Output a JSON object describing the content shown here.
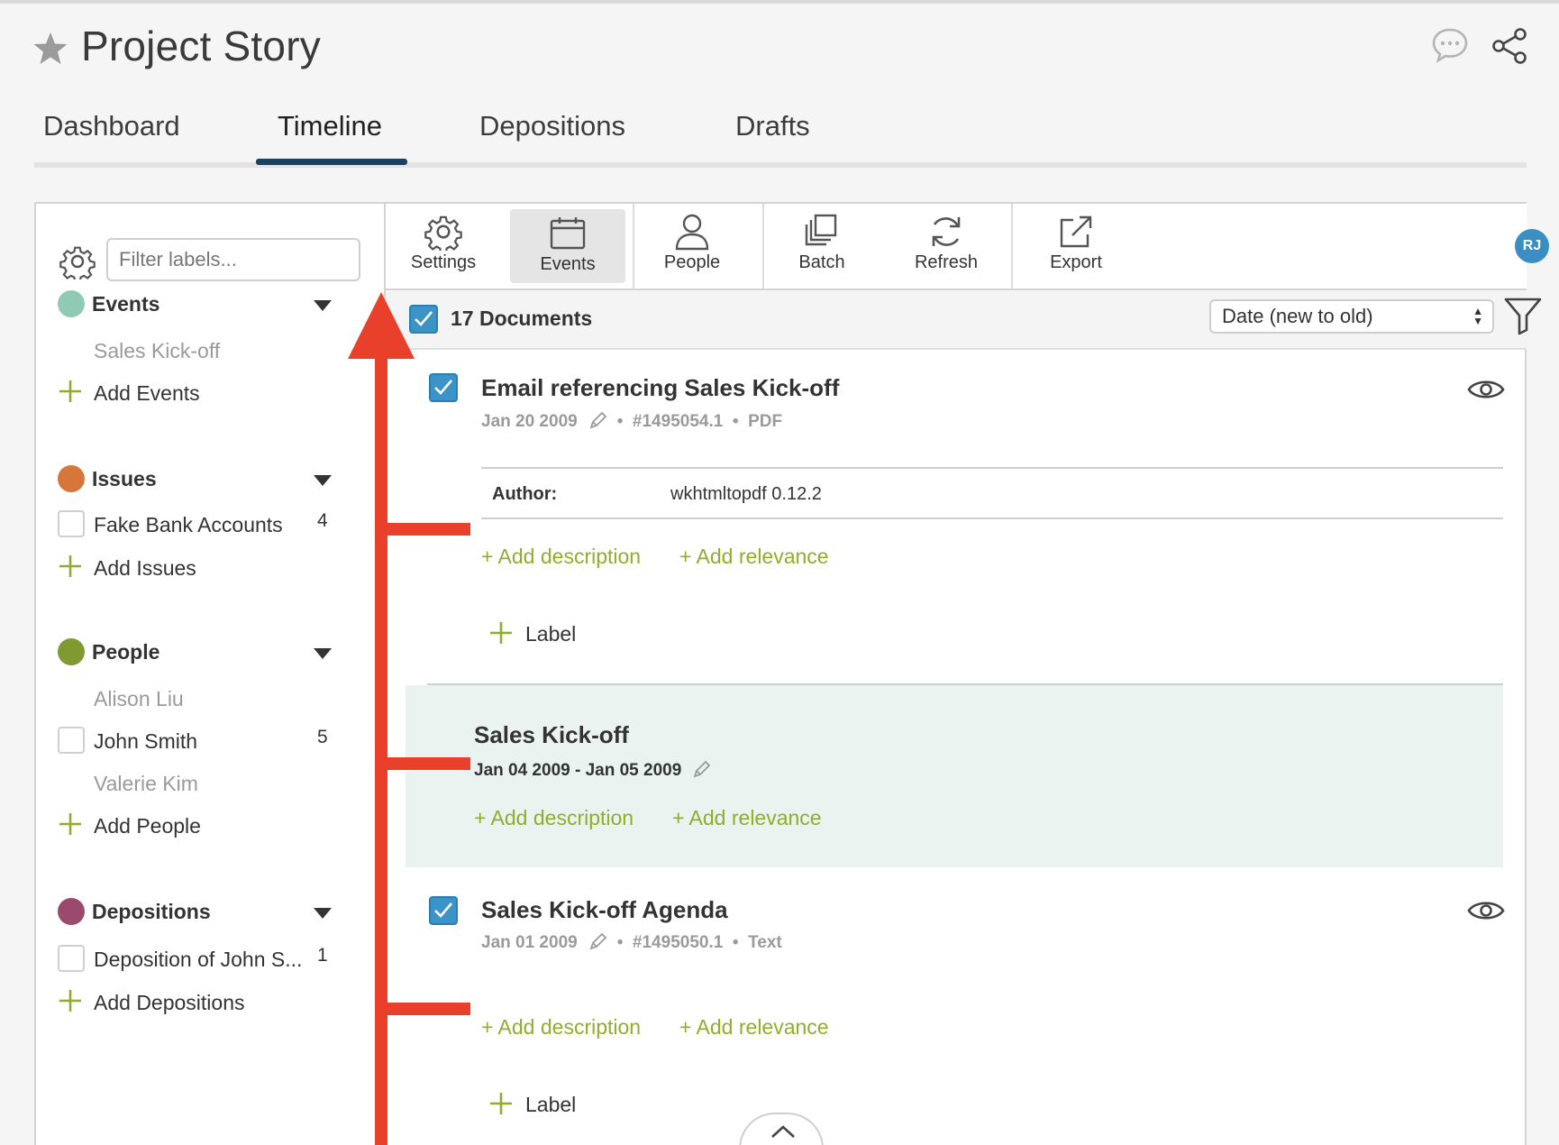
{
  "app": {
    "title": "Project Story"
  },
  "header_icons": {
    "star": "star-icon",
    "comment": "comment-icon",
    "share": "share-icon"
  },
  "tabs": [
    {
      "label": "Dashboard",
      "active": false
    },
    {
      "label": "Timeline",
      "active": true
    },
    {
      "label": "Depositions",
      "active": false
    },
    {
      "label": "Drafts",
      "active": false
    }
  ],
  "sidebar": {
    "filter_placeholder": "Filter labels...",
    "sections": [
      {
        "title": "Events",
        "color": "#8fcbb4",
        "items": [
          {
            "label": "Sales Kick-off",
            "muted": true
          }
        ],
        "add_label": "Add Events"
      },
      {
        "title": "Issues",
        "color": "#d6763a",
        "items": [
          {
            "label": "Fake Bank Accounts",
            "count": "4",
            "checkbox": true
          }
        ],
        "add_label": "Add Issues"
      },
      {
        "title": "People",
        "color": "#7e9a30",
        "items": [
          {
            "label": "Alison Liu",
            "muted": true
          },
          {
            "label": "John Smith",
            "count": "5",
            "checkbox": true
          },
          {
            "label": "Valerie Kim",
            "muted": true
          }
        ],
        "add_label": "Add People"
      },
      {
        "title": "Depositions",
        "color": "#9a4a6c",
        "items": [
          {
            "label": "Deposition of John S...",
            "count": "1",
            "checkbox": true
          }
        ],
        "add_label": "Add Depositions"
      }
    ]
  },
  "toolbar": {
    "buttons": [
      {
        "label": "Settings",
        "icon": "gear-icon"
      },
      {
        "label": "Events",
        "icon": "calendar-icon",
        "active": true
      },
      {
        "label": "People",
        "icon": "person-icon"
      },
      {
        "label": "Batch",
        "icon": "batch-icon"
      },
      {
        "label": "Refresh",
        "icon": "refresh-icon"
      },
      {
        "label": "Export",
        "icon": "export-icon"
      }
    ],
    "avatar_initials": "RJ",
    "avatar_color": "#3a8ec4"
  },
  "documents_bar": {
    "count_label": "17 Documents",
    "sort_value": "Date (new to old)"
  },
  "documents": [
    {
      "title": "Email referencing Sales Kick-off",
      "date": "Jan 20 2009",
      "id": "#1495054.1",
      "type": "PDF",
      "meta_key": "Author:",
      "meta_value": "wkhtmltopdf 0.12.2",
      "add_description": "+ Add description",
      "add_relevance": "+ Add relevance",
      "label": "Label"
    },
    {
      "title": "Sales Kick-off Agenda",
      "date": "Jan 01 2009",
      "id": "#1495050.1",
      "type": "Text",
      "add_description": "+ Add description",
      "add_relevance": "+ Add relevance",
      "label": "Label"
    }
  ],
  "event_card": {
    "title": "Sales Kick-off",
    "dates": "Jan 04 2009 - Jan 05 2009",
    "add_description": "+ Add description",
    "add_relevance": "+ Add relevance",
    "background": "#eaf3f0"
  },
  "meta_separator": "•",
  "colors": {
    "accent_green": "#8fae2b",
    "checkbox_blue": "#3b93c8",
    "tab_underline": "#1f3f5e",
    "annotation_red": "#e8402a"
  }
}
